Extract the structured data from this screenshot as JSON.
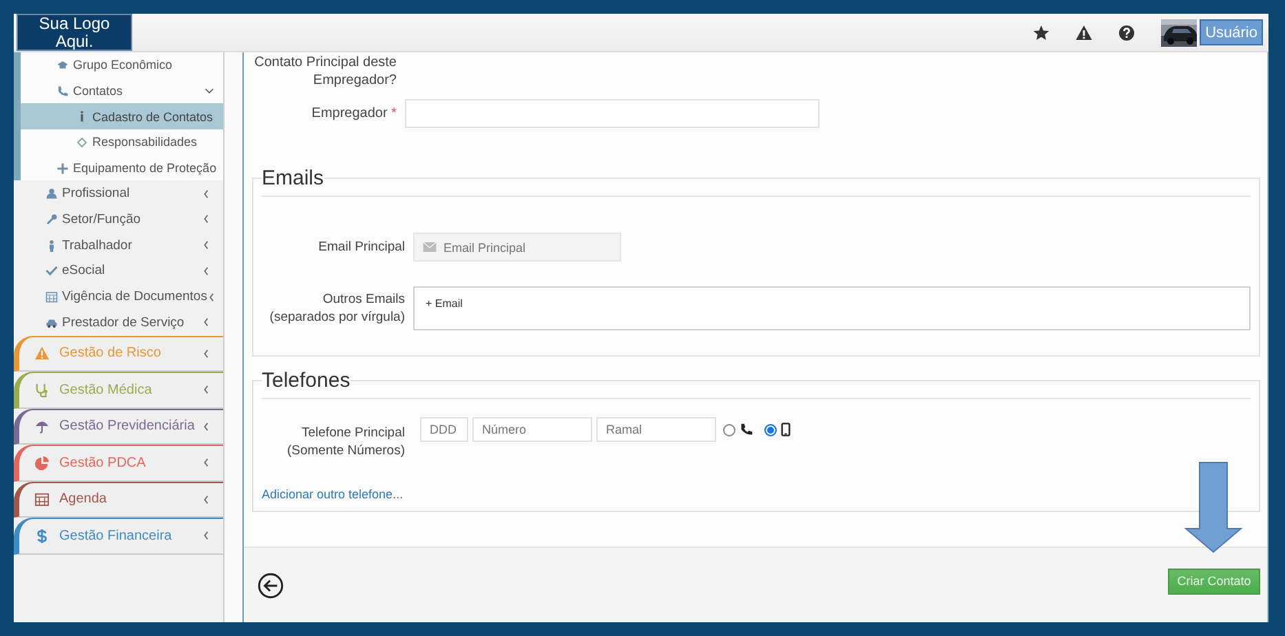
{
  "header": {
    "logo": "Sua Logo Aqui.",
    "user": "Usuário"
  },
  "sidebar": {
    "submenu": [
      {
        "label": "Grupo Econômico",
        "selected": false
      },
      {
        "label": "Contatos",
        "selected": false,
        "expanded": true,
        "children": [
          {
            "label": "Cadastro de Contatos",
            "selected": true
          },
          {
            "label": "Responsabilidades",
            "selected": false
          }
        ]
      },
      {
        "label": "Equipamento de Proteção",
        "selected": false
      }
    ],
    "menu": [
      {
        "label": "Profissional",
        "selected": false
      },
      {
        "label": "Setor/Função",
        "selected": false
      },
      {
        "label": "Trabalhador",
        "selected": false
      },
      {
        "label": "eSocial",
        "selected": false
      },
      {
        "label": "Vigência de Documentos",
        "selected": false
      },
      {
        "label": "Prestador de Serviço",
        "selected": false
      }
    ],
    "modules": [
      {
        "label": "Gestão de Risco",
        "color": "#e8963a"
      },
      {
        "label": "Gestão Médica",
        "color": "#9aad4c"
      },
      {
        "label": "Gestão Previdenciária",
        "color": "#7b6a93"
      },
      {
        "label": "Gestão PDCA",
        "color": "#e0685e"
      },
      {
        "label": "Agenda",
        "color": "#a0584a"
      },
      {
        "label": "Gestão Financeira",
        "color": "#3d8cc4"
      }
    ]
  },
  "form": {
    "question_lines": [
      "Contato Principal deste",
      "Empregador?"
    ],
    "employer": {
      "label": "Empregador",
      "required_mark": "*"
    }
  },
  "emails": {
    "title": "Emails",
    "primary": {
      "label": "Email Principal",
      "placeholder": "Email Principal"
    },
    "others": {
      "label_lines": [
        "Outros Emails",
        "(separados por vírgula)"
      ],
      "add_label": "+ Email"
    }
  },
  "phones": {
    "title": "Telefones",
    "label_lines": [
      "Telefone Principal",
      "(Somente Números)"
    ],
    "fields": [
      {
        "placeholder": "DDD"
      },
      {
        "placeholder": "Número"
      },
      {
        "placeholder": "Ramal"
      }
    ],
    "types": [
      {
        "kind": "landline",
        "selected": false
      },
      {
        "kind": "mobile",
        "selected": true
      }
    ],
    "add_link": "Adicionar outro telefone..."
  },
  "footer": {
    "submit": "Criar Contato"
  }
}
